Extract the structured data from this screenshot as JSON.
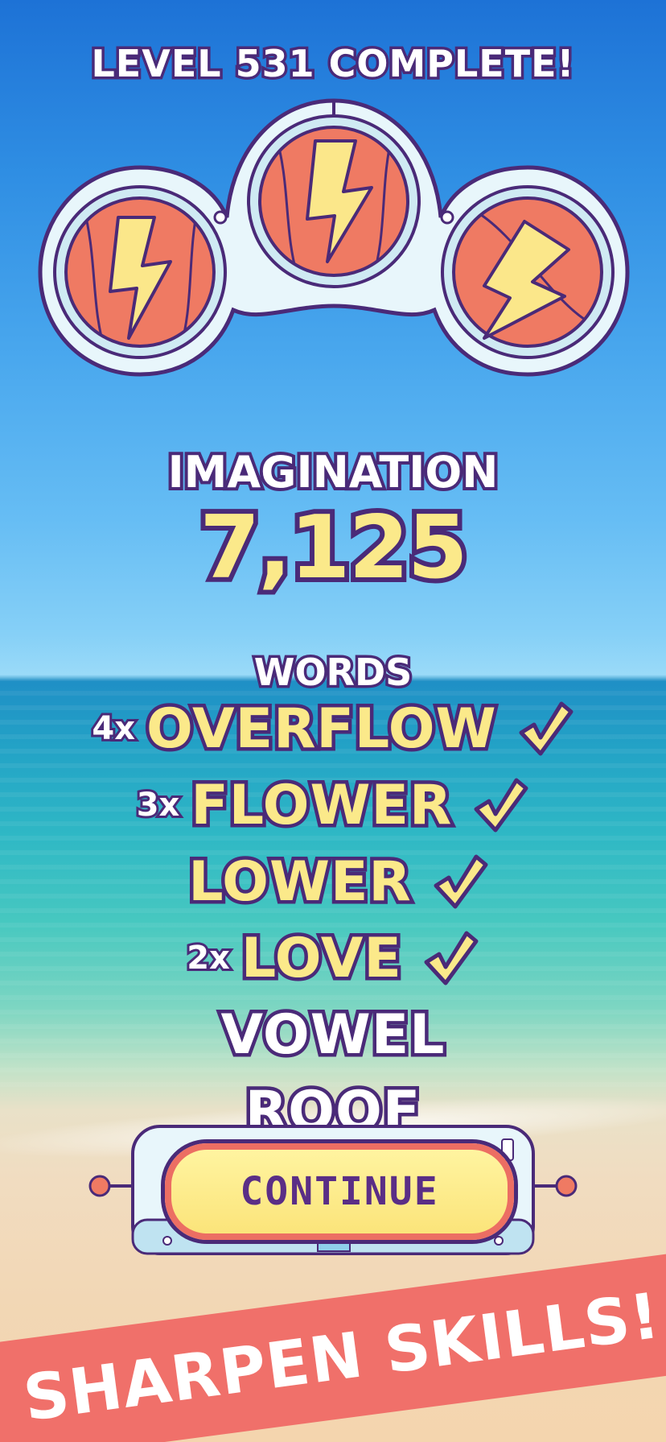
{
  "title": "LEVEL 531 COMPLETE!",
  "badges": [
    {
      "icon": "lightning-bolt-icon"
    },
    {
      "icon": "lightning-bolt-icon"
    },
    {
      "icon": "lightning-bolt-icon"
    }
  ],
  "imagination": {
    "label": "IMAGINATION",
    "score": "7,125"
  },
  "words": {
    "label": "WORDS",
    "items": [
      {
        "multiplier": "4x",
        "word": "OVERFLOW",
        "found": true
      },
      {
        "multiplier": "3x",
        "word": "FLOWER",
        "found": true
      },
      {
        "multiplier": "",
        "word": "LOWER",
        "found": true
      },
      {
        "multiplier": "2x",
        "word": "LOVE",
        "found": true
      },
      {
        "multiplier": "",
        "word": "VOWEL",
        "found": false
      },
      {
        "multiplier": "",
        "word": "ROOF",
        "found": false
      }
    ]
  },
  "continue_button": {
    "label": "CONTINUE"
  },
  "banner": {
    "text": "SHARPEN SKILLS!"
  },
  "colors": {
    "word_found": "#fbe98a",
    "outline": "#4a2a78",
    "banner": "#f0706a",
    "button_fill": "#fbe47a",
    "button_border": "#ec6e63",
    "badge_red": "#ef7a63",
    "badge_yellow": "#fbe78a",
    "badge_frame": "#e8f6fb"
  }
}
